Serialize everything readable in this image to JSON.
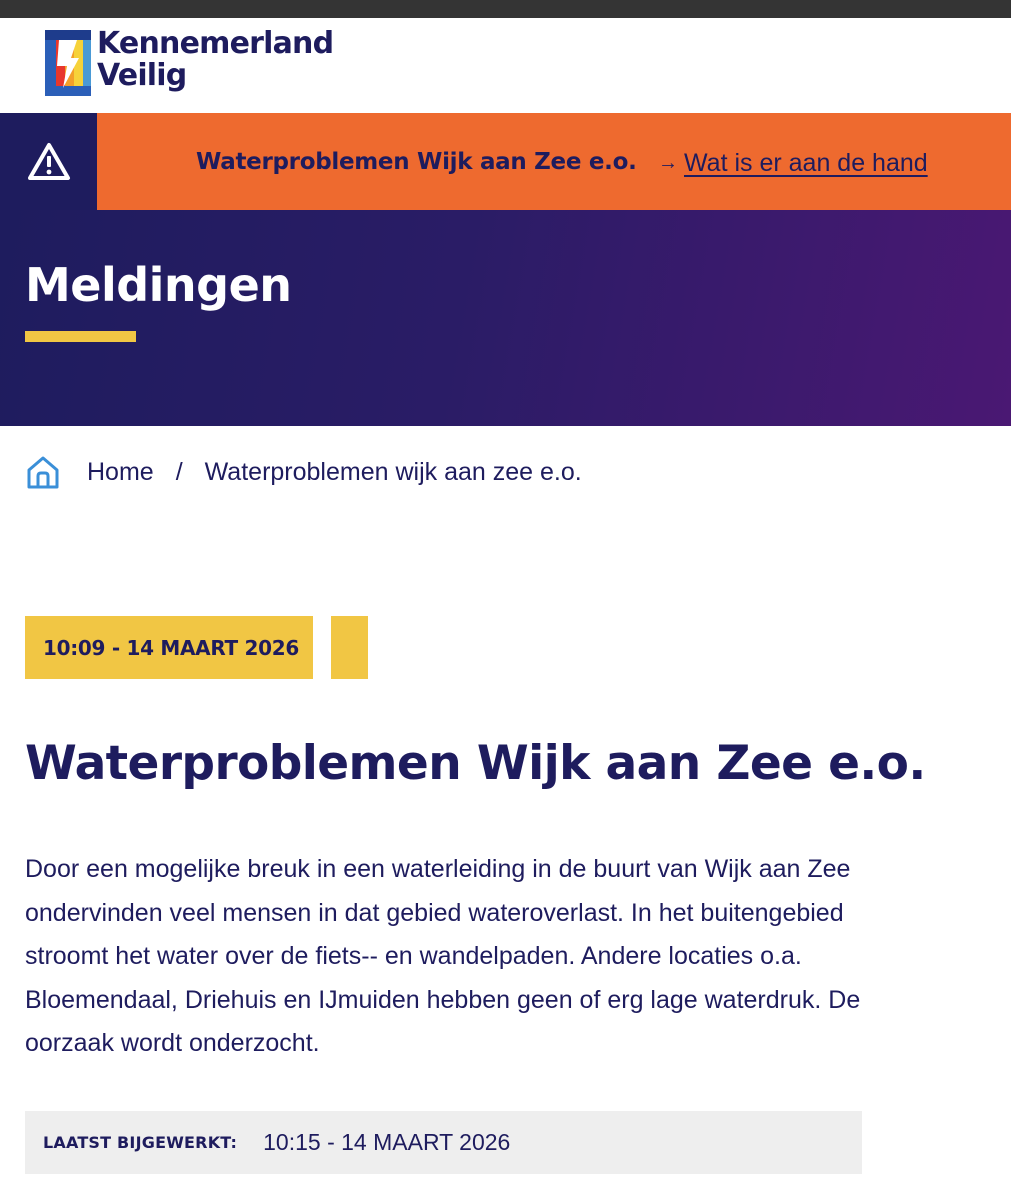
{
  "brand": {
    "name_line1": "Kennemerland",
    "name_line2": "Veilig",
    "colors": {
      "navy": "#1e1c5e",
      "orange": "#ee6a2f",
      "yellow": "#f1c644",
      "purple": "#4a1873"
    }
  },
  "alert": {
    "icon": "warning-triangle-icon",
    "title": "Waterproblemen Wijk aan Zee e.o.",
    "link_arrow": "→",
    "link_label": "Wat is er aan de hand"
  },
  "hero": {
    "title": "Meldingen"
  },
  "breadcrumb": {
    "home_icon": "home-icon",
    "home_label": "Home",
    "separator": "/",
    "current": "Waterproblemen wijk aan zee e.o."
  },
  "article": {
    "date_tag": "10:09 - 14 MAART 2026",
    "title": "Waterproblemen Wijk aan Zee e.o.",
    "body": "Door een mogelijke breuk in een waterleiding in de buurt van Wijk aan Zee ondervinden veel mensen in dat gebied wateroverlast. In het buitengebied stroomt het water over de fiets-- en wandelpaden. Andere locaties o.a. Bloemendaal, Driehuis en IJmuiden hebben geen of erg lage waterdruk. De oorzaak wordt onderzocht.",
    "updated_label": "LAATST BIJGEWERKT:",
    "updated_value": "10:15 - 14 MAART 2026"
  }
}
